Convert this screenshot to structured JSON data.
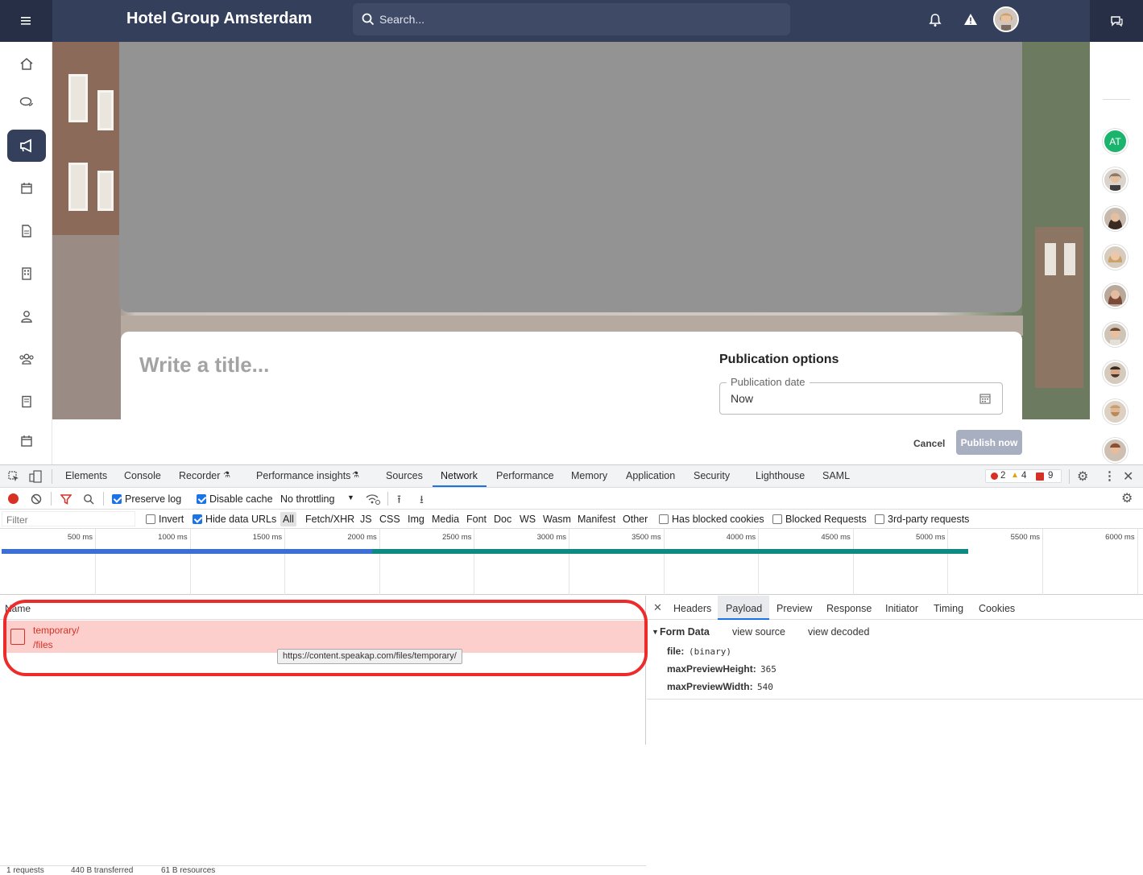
{
  "app": {
    "title": "Hotel Group Amsterdam",
    "search_placeholder": "Search..."
  },
  "editor": {
    "title_placeholder": "Write a title...",
    "publication_options": "Publication options",
    "publication_date_label": "Publication date",
    "publication_date_value": "Now",
    "cancel": "Cancel",
    "publish_now": "Publish now"
  },
  "sidebar_right": {
    "first_avatar_initials": "AT"
  },
  "devtools": {
    "tabs": [
      "Elements",
      "Console",
      "Recorder",
      "Performance insights",
      "Sources",
      "Network",
      "Performance",
      "Memory",
      "Application",
      "Security",
      "Lighthouse",
      "SAML"
    ],
    "active_tab": "Network",
    "counts": {
      "errors": "2",
      "warnings": "4",
      "issues": "9"
    },
    "toolbar": {
      "preserve_log": "Preserve log",
      "disable_cache": "Disable cache",
      "throttling": "No throttling"
    },
    "filter": {
      "placeholder": "Filter",
      "invert": "Invert",
      "hide_data_urls": "Hide data URLs",
      "types": [
        "All",
        "Fetch/XHR",
        "JS",
        "CSS",
        "Img",
        "Media",
        "Font",
        "Doc",
        "WS",
        "Wasm",
        "Manifest",
        "Other"
      ],
      "has_blocked_cookies": "Has blocked cookies",
      "blocked_requests": "Blocked Requests",
      "third_party": "3rd-party requests"
    },
    "timeline_ticks": [
      "500 ms",
      "1000 ms",
      "1500 ms",
      "2000 ms",
      "2500 ms",
      "3000 ms",
      "3500 ms",
      "4000 ms",
      "4500 ms",
      "5000 ms",
      "5500 ms",
      "6000 ms"
    ],
    "request_list": {
      "name_header": "Name",
      "row_line1": "temporary/",
      "row_line2": "/files",
      "tooltip": "https://content.speakap.com/files/temporary/"
    },
    "detail_tabs": [
      "Headers",
      "Payload",
      "Preview",
      "Response",
      "Initiator",
      "Timing",
      "Cookies"
    ],
    "payload": {
      "section": "Form Data",
      "view_source": "view source",
      "view_decoded": "view decoded",
      "fields": [
        {
          "key": "file:",
          "value": "(binary)"
        },
        {
          "key": "maxPreviewHeight:",
          "value": "365"
        },
        {
          "key": "maxPreviewWidth:",
          "value": "540"
        }
      ]
    },
    "status": {
      "requests": "1 requests",
      "transferred": "440 B transferred",
      "resources": "61 B resources"
    }
  }
}
